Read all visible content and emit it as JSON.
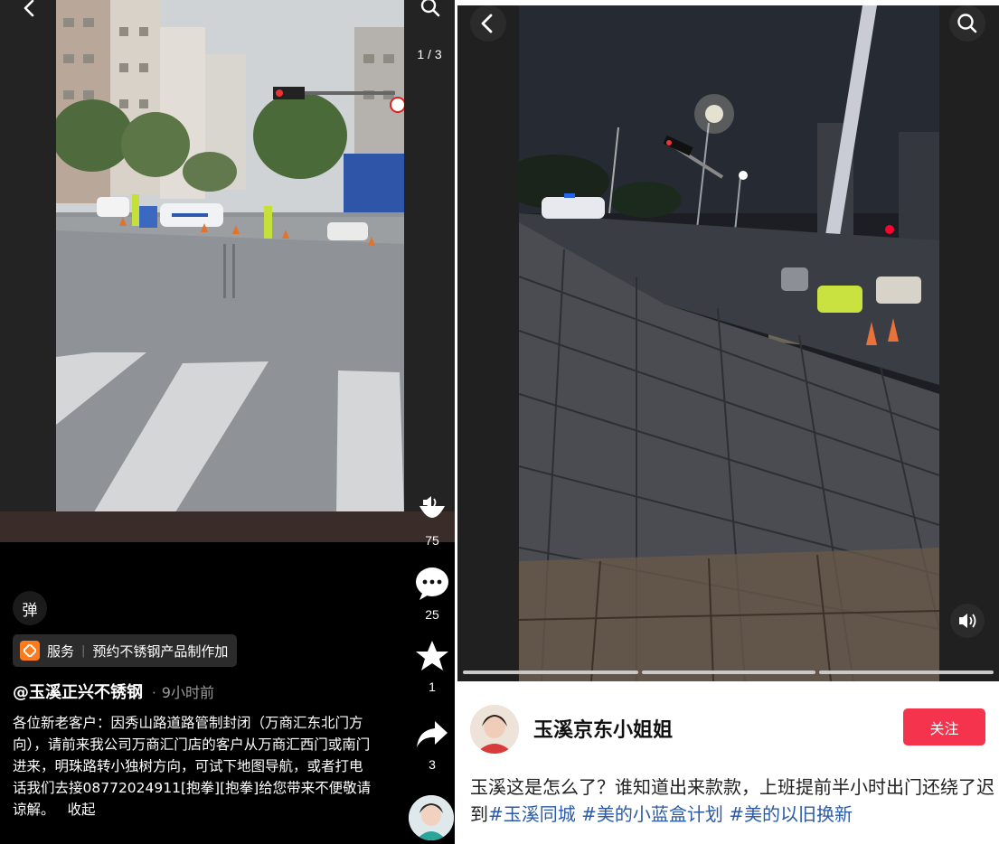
{
  "left": {
    "page_indicator": "1 / 3",
    "like_count": "75",
    "comment_count": "25",
    "favorite_count": "1",
    "share_count": "3",
    "danmu_label": "弹",
    "service_label": "服务",
    "service_text": "预约不锈钢产品制作加",
    "author": "@玉溪正兴不锈钢",
    "time": "9小时前",
    "description": "各位新老客户：因秀山路道路管制封闭（万商汇东北门方向），请前来我公司万商汇门店的客户从万商汇西门或南门进来，明珠路转小独树方向，可试下地图导航，或者打电话我们去接08772024911[抱拳][抱拳]给您带来不便敬请谅解。",
    "collapse_label": "收起"
  },
  "right": {
    "username": "玉溪京东小姐姐",
    "follow_label": "关注",
    "caption_text": "玉溪这是怎么了？谁知道出来款款，上班提前半小时出门还绕了迟到",
    "tags": [
      "#玉溪同城",
      " #美的小蓝盒计划",
      " #美的以旧换新"
    ]
  },
  "icons": {
    "back": "chevron-left-icon",
    "search": "search-icon",
    "sound": "speaker-icon",
    "comment": "comment-icon",
    "favorite": "star-icon",
    "share": "share-icon"
  },
  "colors": {
    "follow_button": "#f6334d",
    "hashtag": "#2a5aa8",
    "service_icon": "#ff7a1a"
  }
}
